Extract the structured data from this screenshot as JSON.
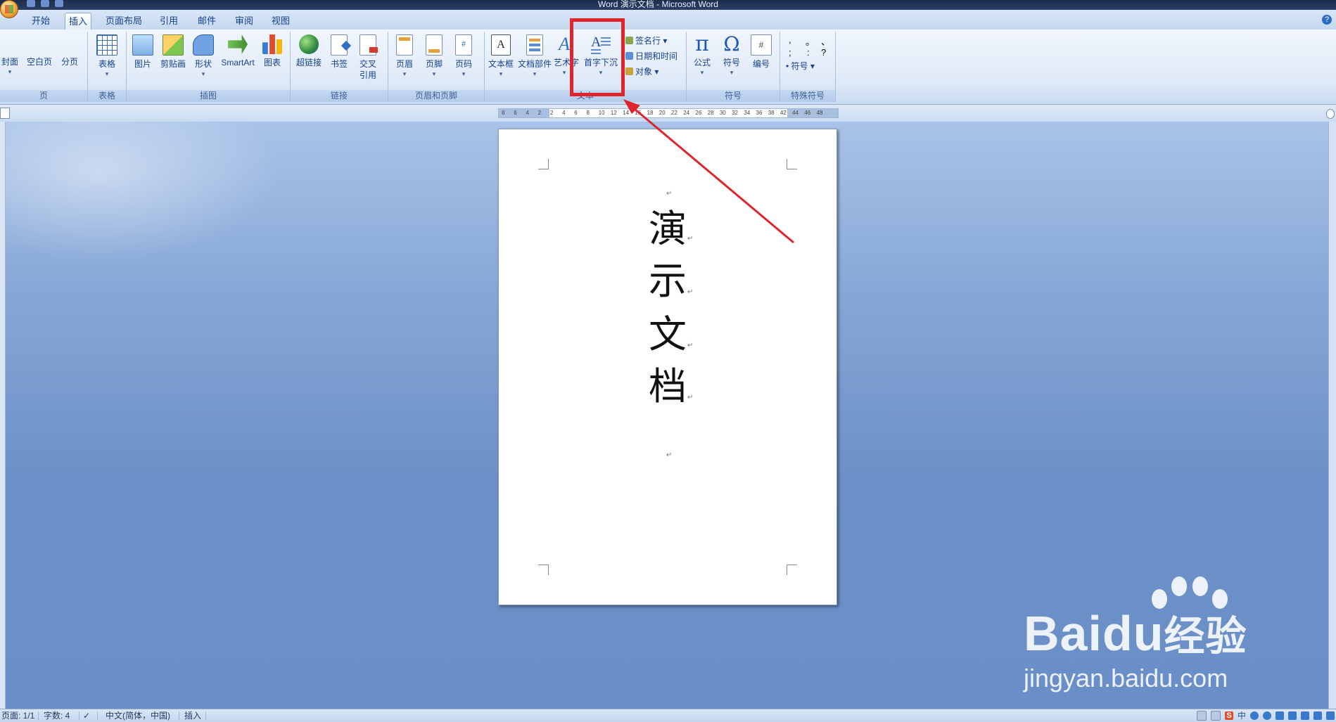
{
  "window": {
    "title": "Word 演示文档 - Microsoft Word"
  },
  "tabs": [
    "开始",
    "插入",
    "页面布局",
    "引用",
    "邮件",
    "审阅",
    "视图"
  ],
  "active_tab": "插入",
  "ribbon": {
    "groups": {
      "pages": {
        "label": "页",
        "buttons": [
          "封面",
          "空白页",
          "分页"
        ]
      },
      "tables": {
        "label": "表格",
        "buttons": [
          "表格"
        ]
      },
      "illustrations": {
        "label": "插图",
        "buttons": [
          "图片",
          "剪贴画",
          "形状",
          "SmartArt",
          "图表"
        ]
      },
      "links": {
        "label": "链接",
        "buttons": [
          "超链接",
          "书签",
          "交叉",
          "引用"
        ]
      },
      "header_footer": {
        "label": "页眉和页脚",
        "buttons": [
          "页眉",
          "页脚",
          "页码"
        ]
      },
      "text": {
        "label": "文本",
        "buttons": [
          "文本框",
          "文档部件",
          "艺术字",
          "首字下沉"
        ],
        "small_buttons": [
          "签名行",
          "日期和时间",
          "对象"
        ]
      },
      "symbols": {
        "label": "符号",
        "buttons": [
          "公式",
          "符号",
          "编号"
        ]
      },
      "special": {
        "label": "特殊符号",
        "glyphs": [
          ",",
          "。",
          "、",
          ";",
          ":",
          "?"
        ],
        "button": "符号"
      }
    },
    "highlighted_button": "首字下沉"
  },
  "ruler": {
    "ticks": [
      "8",
      "6",
      "4",
      "2",
      "2",
      "4",
      "6",
      "8",
      "10",
      "12",
      "14",
      "16",
      "18",
      "20",
      "22",
      "24",
      "26",
      "28",
      "30",
      "32",
      "34",
      "36",
      "38",
      "42",
      "44",
      "46",
      "48"
    ]
  },
  "document": {
    "lines": [
      "演",
      "示",
      "文",
      "档"
    ]
  },
  "status": {
    "page": "页面: 1/1",
    "words": "字数: 4",
    "language": "中文(简体，中国)",
    "mode": "插入"
  },
  "tray": {
    "ime": "S",
    "ime_lang": "中"
  },
  "watermark": {
    "brand": "Bai",
    "brand_mid": "du",
    "brand_cn": "经验",
    "url": "jingyan.baidu.com"
  },
  "colors": {
    "highlight": "#e0242b",
    "ribbon_text": "#15428b",
    "workspace": "#6f93c6"
  }
}
